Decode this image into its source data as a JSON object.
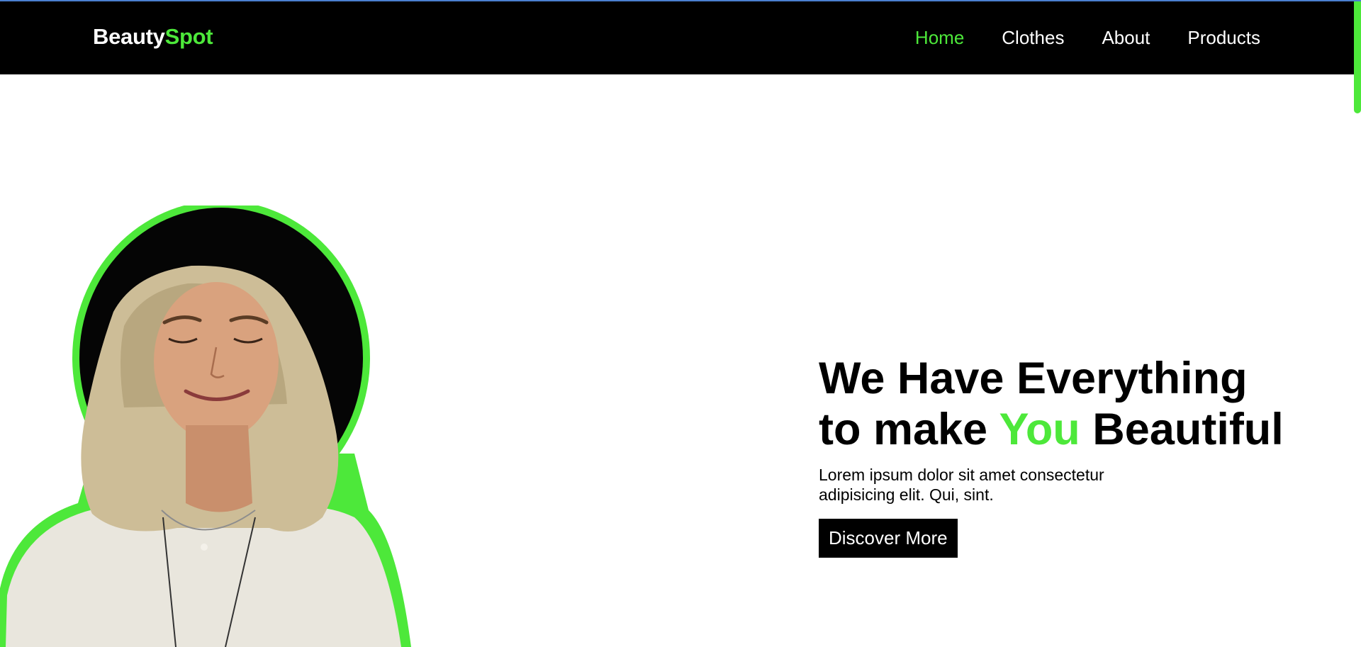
{
  "brand": {
    "name_part1": "Beauty",
    "name_part2": "Spot"
  },
  "nav": {
    "items": [
      {
        "label": "Home",
        "active": true
      },
      {
        "label": "Clothes",
        "active": false
      },
      {
        "label": "About",
        "active": false
      },
      {
        "label": "Products",
        "active": false
      }
    ]
  },
  "hero": {
    "title_line1": "We Have Everything",
    "title_line2_pre": "to make ",
    "title_line2_accent": "You",
    "title_line2_post": " Beautiful",
    "subtitle": "Lorem ipsum dolor sit amet consectetur adipisicing elit. Qui, sint.",
    "cta_label": "Discover More"
  },
  "colors": {
    "accent": "#4de83a",
    "navbar_bg": "#000000",
    "background": "#ffffff",
    "text": "#000000"
  },
  "icons": {
    "hero_image": "woman-portrait-image"
  }
}
